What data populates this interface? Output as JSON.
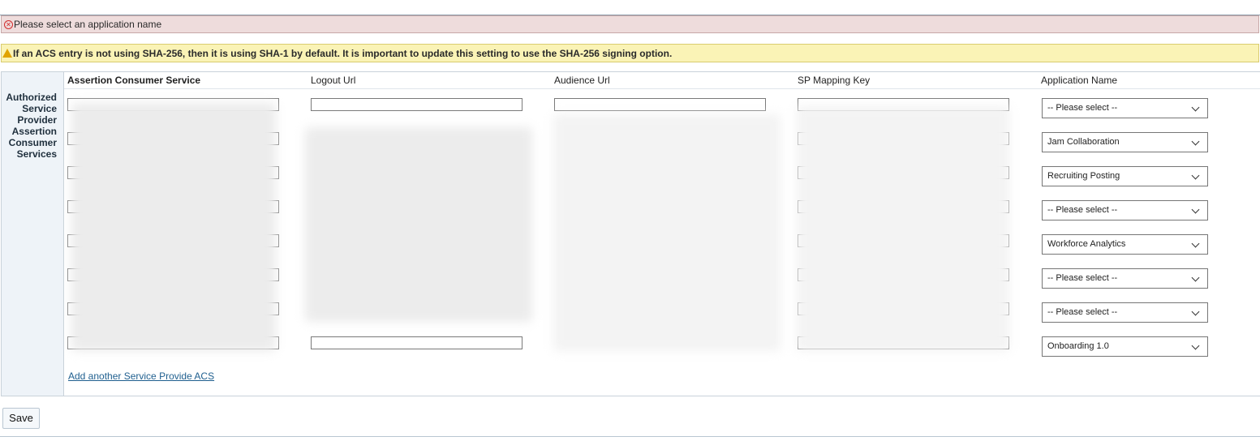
{
  "messages": {
    "error": "Please select an application name",
    "warning": "If an ACS entry is not using SHA-256, then it is using SHA-1 by default. It is important to update this setting to use the SHA-256 signing option."
  },
  "section": {
    "label_lines": [
      "Authorized",
      "Service",
      "Provider",
      "Assertion",
      "Consumer",
      "Services"
    ]
  },
  "columns": {
    "acs": "Assertion Consumer Service",
    "logout": "Logout Url",
    "audience": "Audience Url",
    "sp_key": "SP Mapping Key",
    "app_name": "Application Name"
  },
  "rows": [
    {
      "application": "-- Please select --"
    },
    {
      "application": "Jam Collaboration"
    },
    {
      "application": "Recruiting Posting"
    },
    {
      "application": "-- Please select --"
    },
    {
      "application": "Workforce Analytics"
    },
    {
      "application": "-- Please select --"
    },
    {
      "application": "-- Please select --"
    },
    {
      "application": "Onboarding 1.0"
    }
  ],
  "add_link": "Add another Service Provide ACS",
  "save_label": "Save",
  "colors": {
    "error_bg": "#eedcdc",
    "warning_bg": "#faf3b6",
    "link": "#1f5f8f",
    "label_col_bg": "#eef3f8"
  },
  "icons": {
    "error": "error-circle-icon",
    "warning": "warning-triangle-icon",
    "select": "chevron-down-icon"
  }
}
